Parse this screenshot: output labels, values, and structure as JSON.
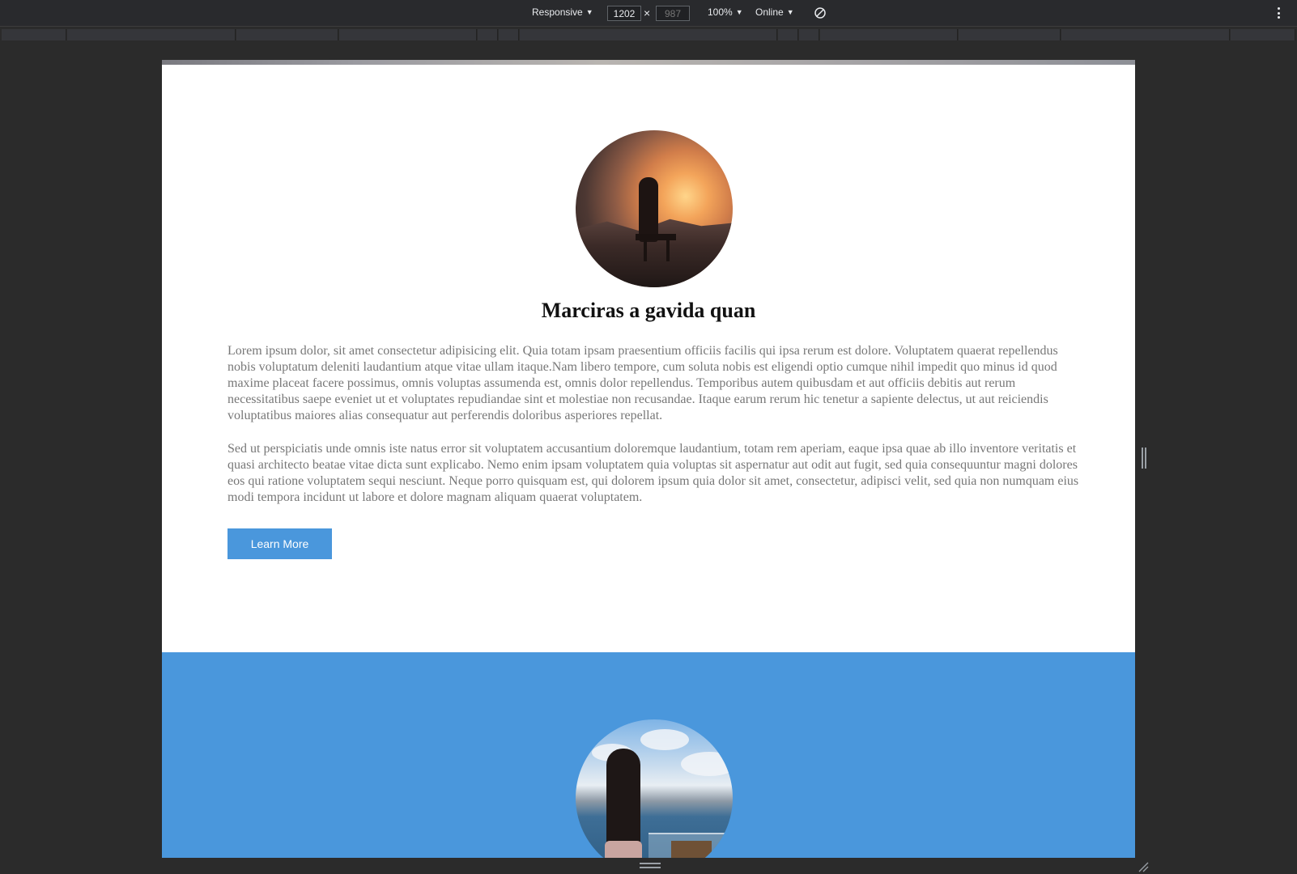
{
  "devtools": {
    "device_mode": "Responsive",
    "width_value": "1202",
    "height_placeholder": "987",
    "times_symbol": "×",
    "zoom": "100%",
    "throttling": "Online",
    "icons": [
      "chevron-down-icon",
      "rotate-icon",
      "more-vertical-icon"
    ]
  },
  "page": {
    "section_one": {
      "heading": "Marciras a gavida quan",
      "paragraph_1": "Lorem ipsum dolor, sit amet consectetur adipisicing elit. Quia totam ipsam praesentium officiis facilis qui ipsa rerum est dolore. Voluptatem quaerat repellendus nobis voluptatum deleniti laudantium atque vitae ullam itaque.Nam libero tempore, cum soluta nobis est eligendi optio cumque nihil impedit quo minus id quod maxime placeat facere possimus, omnis voluptas assumenda est, omnis dolor repellendus. Temporibus autem quibusdam et aut officiis debitis aut rerum necessitatibus saepe eveniet ut et voluptates repudiandae sint et molestiae non recusandae. Itaque earum rerum hic tenetur a sapiente delectus, ut aut reiciendis voluptatibus maiores alias consequatur aut perferendis doloribus asperiores repellat.",
      "paragraph_2": "Sed ut perspiciatis unde omnis iste natus error sit voluptatem accusantium doloremque laudantium, totam rem aperiam, eaque ipsa quae ab illo inventore veritatis et quasi architecto beatae vitae dicta sunt explicabo. Nemo enim ipsam voluptatem quia voluptas sit aspernatur aut odit aut fugit, sed quia consequuntur magni dolores eos qui ratione voluptatem sequi nesciunt. Neque porro quisquam est, qui dolorem ipsum quia dolor sit amet, consectetur, adipisci velit, sed quia non numquam eius modi tempora incidunt ut labore et dolore magnam aliquam quaerat voluptatem.",
      "button_label": "Learn More",
      "image": "sunset-silhouette-bench"
    },
    "section_two": {
      "image": "woman-at-lake-view"
    }
  },
  "colors": {
    "accent_blue": "#4a97dc",
    "devtools_bg": "#292a2d",
    "text_gray": "#777777",
    "heading": "#111111"
  }
}
